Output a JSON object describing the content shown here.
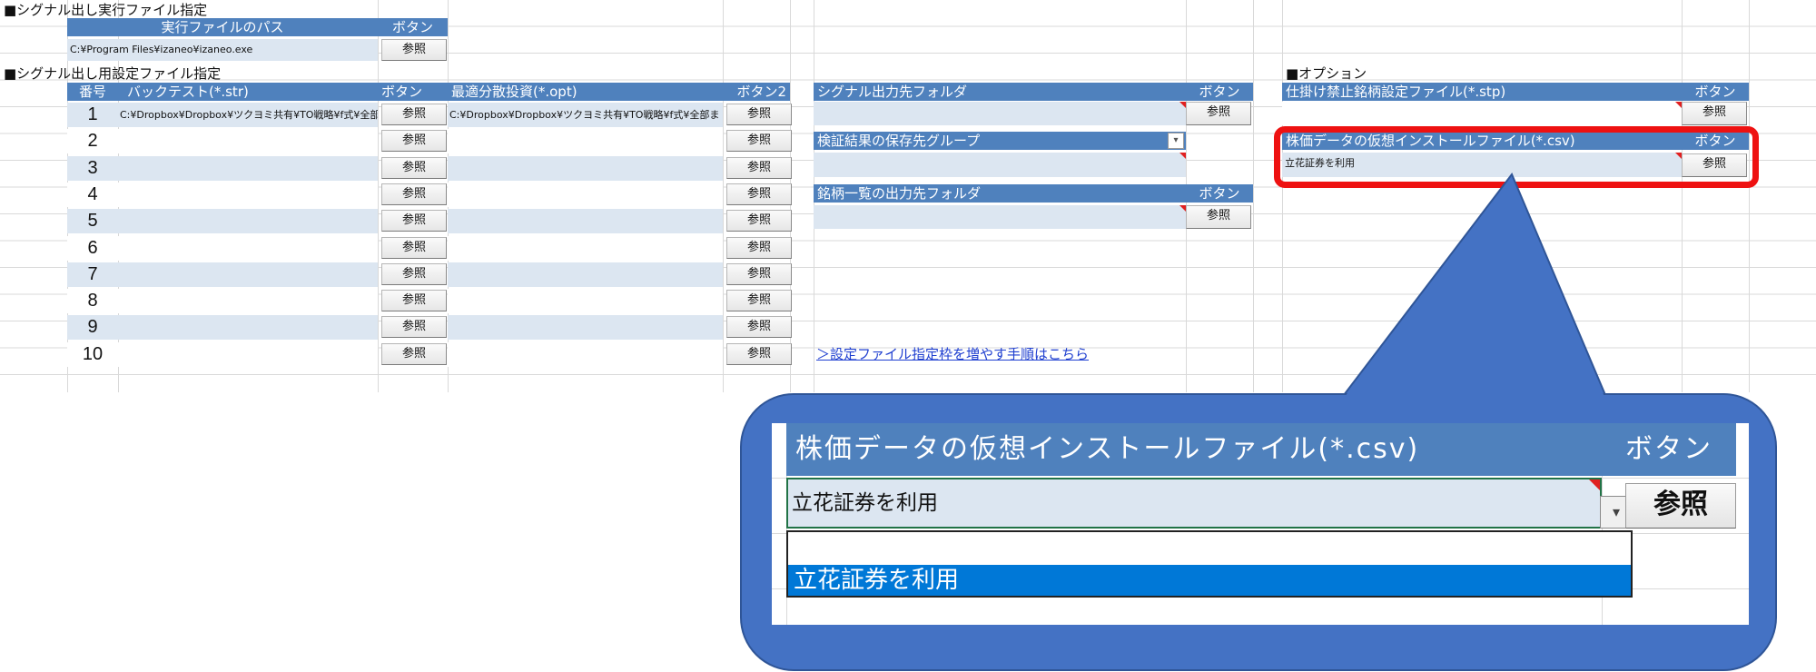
{
  "sections": {
    "signal_exec": "■シグナル出し実行ファイル指定",
    "signal_settings": "■シグナル出し用設定ファイル指定",
    "options": "■オプション"
  },
  "exec_table": {
    "header_path": "実行ファイルのパス",
    "header_button": "ボタン",
    "path_value": "C:¥Program Files¥izaneo¥izaneo.exe",
    "button_label": "参照"
  },
  "settings_table": {
    "header_no": "番号",
    "header_backtest": "バックテスト(*.str)",
    "header_button": "ボタン",
    "header_opt": "最適分散投資(*.opt)",
    "header_button2": "ボタン2",
    "button_label": "参照",
    "rows": [
      {
        "no": "1",
        "backtest": "C:¥Dropbox¥Dropbox¥ツクヨミ共有¥TO戦略¥f式¥全部",
        "opt": "C:¥Dropbox¥Dropbox¥ツクヨミ共有¥TO戦略¥f式¥全部ま"
      },
      {
        "no": "2",
        "backtest": "",
        "opt": ""
      },
      {
        "no": "3",
        "backtest": "",
        "opt": ""
      },
      {
        "no": "4",
        "backtest": "",
        "opt": ""
      },
      {
        "no": "5",
        "backtest": "",
        "opt": ""
      },
      {
        "no": "6",
        "backtest": "",
        "opt": ""
      },
      {
        "no": "7",
        "backtest": "",
        "opt": ""
      },
      {
        "no": "8",
        "backtest": "",
        "opt": ""
      },
      {
        "no": "9",
        "backtest": "",
        "opt": ""
      },
      {
        "no": "10",
        "backtest": "",
        "opt": ""
      }
    ]
  },
  "middle": {
    "signal_output_folder": "シグナル出力先フォルダ",
    "header_button": "ボタン",
    "result_group": "検証結果の保存先グループ",
    "stock_list_folder": "銘柄一覧の出力先フォルダ",
    "button_label": "参照",
    "howto_link": "＞設定ファイル指定枠を増やす手順はこちら"
  },
  "options": {
    "prohibited_file": "仕掛け禁止銘柄設定ファイル(*.stp)",
    "virtual_install_file": "株価データの仮想インストールファイル(*.csv)",
    "header_button": "ボタン",
    "virtual_install_value": "立花証券を利用",
    "button_label": "参照"
  },
  "zoom": {
    "header": "株価データの仮想インストールファイル(*.csv)",
    "header_button": "ボタン",
    "value": "立花証券を利用",
    "button_label": "参照",
    "dropdown_options": [
      "",
      "立花証券を利用"
    ],
    "selected_option": "立花証券を利用"
  },
  "colors": {
    "header_blue": "#4f81bd",
    "cell_light_blue": "#dce6f1",
    "callout_blue": "#4472c4",
    "highlight_red": "#ee1111",
    "selection_blue": "#0078d7"
  }
}
